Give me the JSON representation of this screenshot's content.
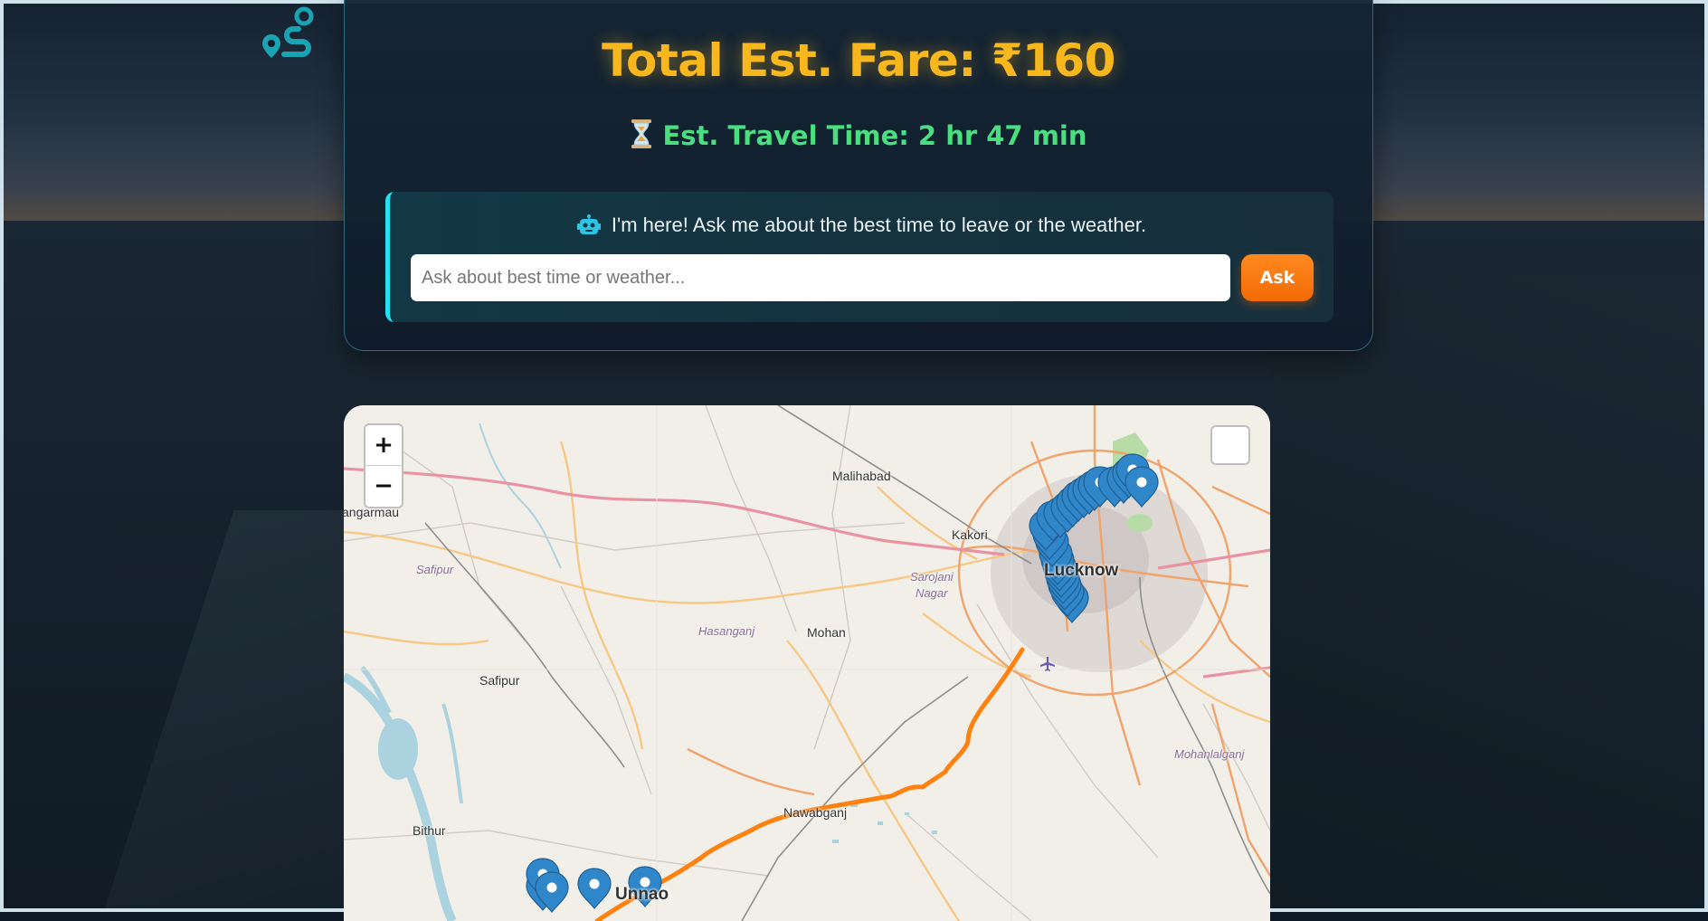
{
  "fare": {
    "text": "Total Est. Fare: ₹160"
  },
  "travel_time": {
    "text": "Est. Travel Time: 2 hr 47 min"
  },
  "assistant": {
    "message": "I'm here! Ask me about the best time to leave or the weather.",
    "input_placeholder": "Ask about best time or weather...",
    "input_value": "",
    "ask_label": "Ask"
  },
  "map": {
    "zoom_in_label": "+",
    "zoom_out_label": "−",
    "route_color": "#ff8210",
    "places": {
      "malihabad": "Malihabad",
      "kakori": "Kakori",
      "sarojani": "Sarojani",
      "nagar": "Nagar",
      "lucknow": "Lucknow",
      "bangarmau": "angarmau",
      "safipur_area": "Safipur",
      "hasanganj": "Hasanganj",
      "mohan": "Mohan",
      "safipur": "Safipur",
      "mohanlalganj": "Mohanlalganj",
      "nawabganj": "Nawabganj",
      "bithur": "Bithur",
      "unnao": "Unnao"
    }
  },
  "colors": {
    "fare": "#f7b71d",
    "travel_time": "#4ade80",
    "accent": "#1de3f2",
    "ask_button": "#f26a05",
    "marker": "#2f86c9"
  }
}
